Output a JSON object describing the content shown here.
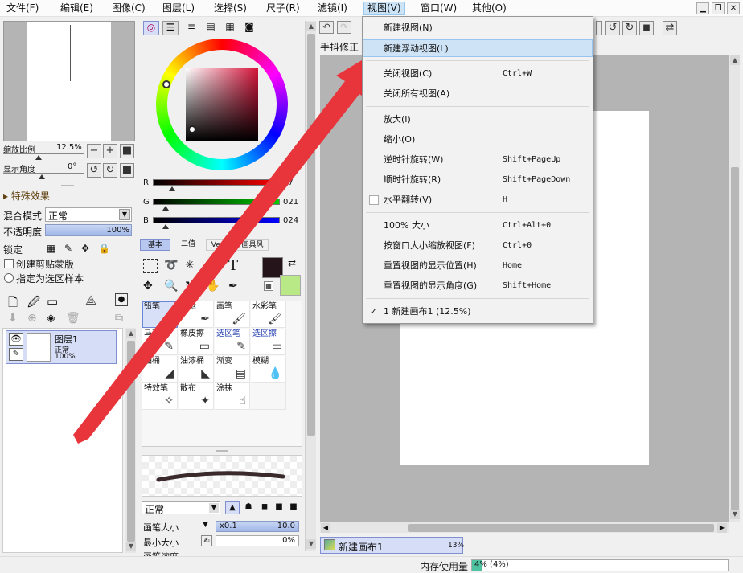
{
  "menu": {
    "items": [
      "文件(F)",
      "编辑(E)",
      "图像(C)",
      "图层(L)",
      "选择(S)",
      "尺子(R)",
      "滤镜(I)",
      "视图(V)",
      "窗口(W)",
      "其他(O)"
    ]
  },
  "navigator": {
    "zoom_label": "缩放比例",
    "zoom_value": "12.5%",
    "angle_label": "显示角度",
    "angle_value": "0°"
  },
  "layer_panel": {
    "effects": "特殊效果",
    "blend_label": "混合模式",
    "blend_value": "正常",
    "opacity_label": "不透明度",
    "opacity_value": "100%",
    "lock_label": "锁定",
    "clip_label": "创建剪贴蒙版",
    "selection_label": "指定为选区样本",
    "layer": {
      "name": "图层1",
      "mode": "正常",
      "opacity": "100%"
    }
  },
  "color": {
    "r_label": "R",
    "r_value": "37",
    "g_label": "G",
    "g_value": "021",
    "b_label": "B",
    "b_value": "024",
    "tabs": [
      "基本",
      "二值",
      "Ver.1",
      "画具风"
    ]
  },
  "tools": [
    {
      "label": "铅笔",
      "icon": "✎"
    },
    {
      "label": "喷枪",
      "icon": "✒"
    },
    {
      "label": "画笔",
      "icon": "🖌"
    },
    {
      "label": "水彩笔",
      "icon": "🖌"
    },
    {
      "label": "马克笔",
      "icon": "✎"
    },
    {
      "label": "橡皮擦",
      "icon": "▭"
    },
    {
      "label": "选区笔",
      "icon": "✎"
    },
    {
      "label": "选区擦",
      "icon": "▭"
    },
    {
      "label": "油桶",
      "icon": "◢"
    },
    {
      "label": "油漆桶",
      "icon": "◣"
    },
    {
      "label": "渐变",
      "icon": "▤"
    },
    {
      "label": "模糊",
      "icon": "💧"
    },
    {
      "label": "特效笔",
      "icon": "✧"
    },
    {
      "label": "散布",
      "icon": "✦"
    },
    {
      "label": "涂抹",
      "icon": "☝"
    },
    {
      "label": "",
      "icon": ""
    }
  ],
  "brush": {
    "mode": "正常",
    "size_label": "画笔大小",
    "size_mult": "x0.1",
    "size_value": "10.0",
    "min_label": "最小大小",
    "min_value": "0%",
    "density_label": "画笔浓度"
  },
  "canvas_toolbar": {
    "stabilizer": "手抖修正"
  },
  "view_menu": {
    "items": [
      {
        "label": "新建视图(N)",
        "shortcut": ""
      },
      {
        "label": "新建浮动视图(L)",
        "shortcut": ""
      },
      {
        "label": "关闭视图(C)",
        "shortcut": "Ctrl+W"
      },
      {
        "label": "关闭所有视图(A)",
        "shortcut": ""
      },
      {
        "label": "放大(I)",
        "shortcut": ""
      },
      {
        "label": "缩小(O)",
        "shortcut": ""
      },
      {
        "label": "逆时针旋转(W)",
        "shortcut": "Shift+PageUp"
      },
      {
        "label": "顺时针旋转(R)",
        "shortcut": "Shift+PageDown"
      },
      {
        "label": "水平翻转(V)",
        "shortcut": "H"
      },
      {
        "label": "100% 大小",
        "shortcut": "Ctrl+Alt+0"
      },
      {
        "label": "按窗口大小缩放视图(F)",
        "shortcut": "Ctrl+0"
      },
      {
        "label": "重置视图的显示位置(H)",
        "shortcut": "Home"
      },
      {
        "label": "重置视图的显示角度(G)",
        "shortcut": "Shift+Home"
      },
      {
        "label": "1 新建画布1 (12.5%)",
        "shortcut": ""
      }
    ]
  },
  "tab": {
    "name": "新建画布1",
    "zoom": "13%"
  },
  "status": {
    "memory_label": "内存使用量",
    "memory_value": "4% (4%)",
    "memory_fraction": 0.04
  },
  "colors": {
    "accent": "#e8343b",
    "canvas_bg": "#b4b4b4",
    "selected_tool": "#d7e0f7",
    "main_color": "#25151a",
    "secondary_color": "#b8e986"
  }
}
